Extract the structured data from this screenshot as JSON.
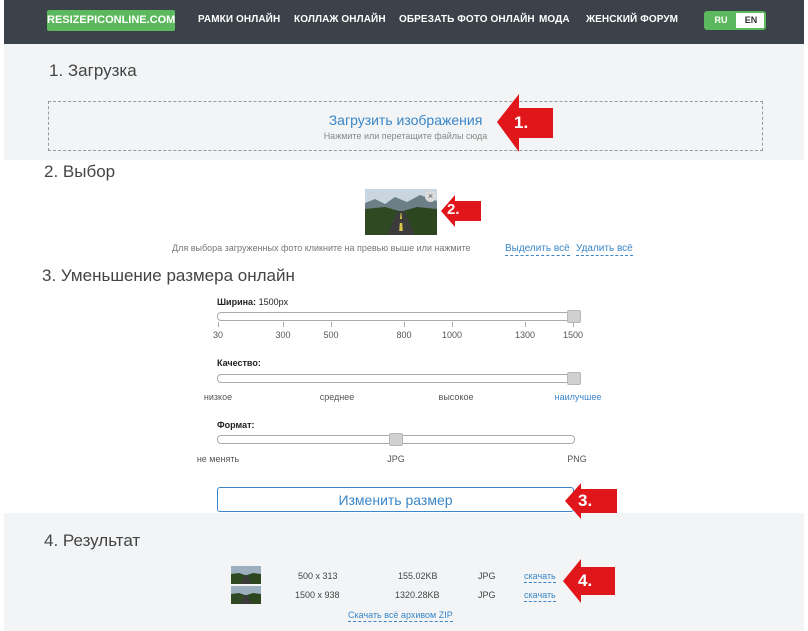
{
  "header": {
    "logo": "RESIZEPICONLINE.COM",
    "nav": [
      "РАМКИ ОНЛАЙН",
      "КОЛЛАЖ ОНЛАЙН",
      "ОБРЕЗАТЬ ФОТО ОНЛАЙН",
      "МОДА",
      "ЖЕНСКИЙ ФОРУМ"
    ],
    "lang": {
      "ru": "RU",
      "en": "EN",
      "active": "RU"
    }
  },
  "upload": {
    "title": "1. Загрузка",
    "dropzone_title": "Загрузить изображения",
    "dropzone_hint": "Нажмите или перетащите файлы сюда"
  },
  "select": {
    "title": "2. Выбор",
    "close_glyph": "×",
    "hint": "Для выбора загруженных фото кликните на превью выше или нажмите",
    "select_all": "Выделить всё",
    "deselect_all": "Удалить всё"
  },
  "resize": {
    "title": "3. Уменьшение размера онлайн",
    "width_label": "Ширина:",
    "width_value": "1500px",
    "width_ticks": [
      "30",
      "300",
      "500",
      "800",
      "1000",
      "1300",
      "1500"
    ],
    "width_selected": "1500",
    "quality_label": "Качество:",
    "quality_ticks": [
      "низкое",
      "среднее",
      "высокое",
      "наилучшее"
    ],
    "quality_selected": "наилучшее",
    "format_label": "Формат:",
    "format_ticks": [
      "не менять",
      "JPG",
      "PNG"
    ],
    "format_selected": "JPG",
    "button": "Изменить размер"
  },
  "result": {
    "title": "4. Результат",
    "rows": [
      {
        "dims": "500 x 313",
        "size": "155.02KB",
        "format": "JPG",
        "link": "скачать"
      },
      {
        "dims": "1500 x 938",
        "size": "1320.28KB",
        "format": "JPG",
        "link": "скачать"
      }
    ],
    "zip_link": "Скачать всё архивом ZIP"
  },
  "callouts": [
    "1.",
    "2.",
    "3.",
    "4."
  ],
  "colors": {
    "accent": "#3a86c8",
    "brand_green": "#5cb85c",
    "header_bg": "#3b4249",
    "callout_red": "#e0161b"
  }
}
